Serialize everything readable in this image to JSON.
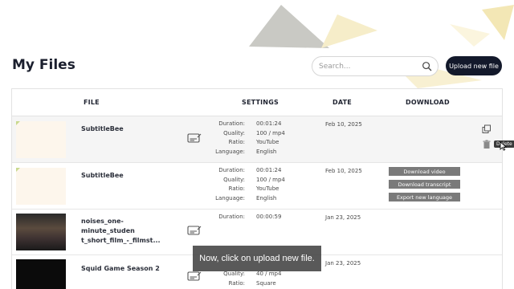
{
  "page": {
    "title": "My Files",
    "search_placeholder": "Search...",
    "upload_button": "Upload new file"
  },
  "table": {
    "headers": [
      "FILE",
      "SETTINGS",
      "DATE",
      "DOWNLOAD"
    ],
    "setting_labels": {
      "duration": "Duration:",
      "quality": "Quality:",
      "ratio": "Ratio:",
      "language": "Language:"
    },
    "rows": [
      {
        "name": "SubtitleBee",
        "duration": "00:01:24",
        "quality": "100 / mp4",
        "ratio": "YouTube",
        "language": "English",
        "date": "Feb 10, 2025"
      },
      {
        "name": "SubtitleBee",
        "duration": "00:01:24",
        "quality": "100 / mp4",
        "ratio": "YouTube",
        "language": "English",
        "date": "Feb 10, 2025",
        "buttons": [
          "Download video",
          "Download transcript",
          "Export new language"
        ]
      },
      {
        "name": "noises_one-minute_studen t_short_film_-_filmst...",
        "duration": "00:00:59",
        "date": "Jan 23, 2025"
      },
      {
        "name": "Squid Game Season 2",
        "quality": "40 / mp4",
        "ratio": "Square",
        "date": "Jan 23, 2025"
      }
    ]
  },
  "tooltip": "Delete",
  "caption": "Now, click on upload new file.",
  "colors": {
    "primary_dark": "#13192b",
    "download_button": "#7a7a7a",
    "accent_yellow": "#f3e7b5"
  },
  "icons": [
    "search-icon",
    "subtitle-icon",
    "duplicate-icon",
    "trash-icon",
    "cursor-icon"
  ]
}
